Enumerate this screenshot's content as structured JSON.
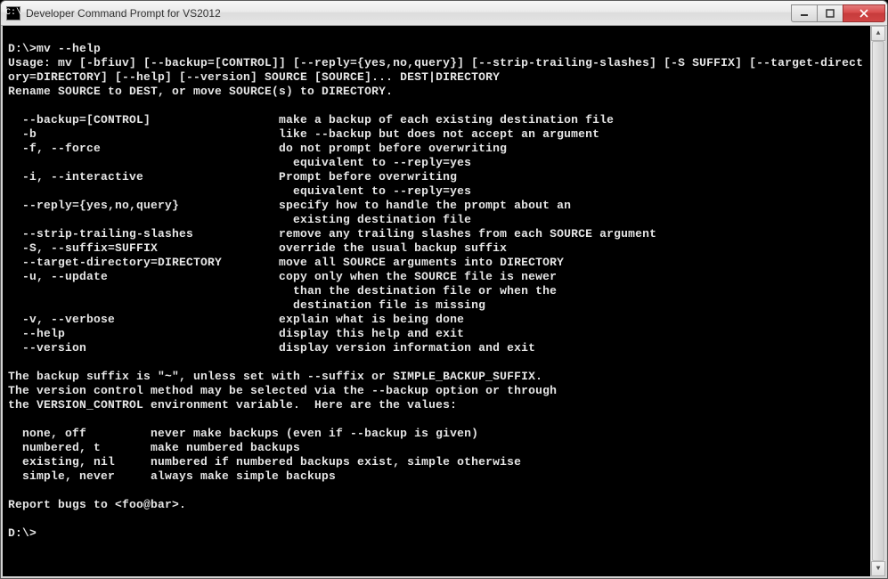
{
  "window": {
    "title": "Developer Command Prompt for VS2012",
    "icon_label": "C:\\"
  },
  "terminal": {
    "prompt1": "D:\\>",
    "command1": "mv --help",
    "usage_line1": "Usage: mv [-bfiuv] [--backup=[CONTROL]] [--reply={yes,no,query}] [--strip-trailing-slashes] [-S SUFFIX] [--target-direct",
    "usage_line2": "ory=DIRECTORY] [--help] [--version] SOURCE [SOURCE]... DEST|DIRECTORY",
    "rename_line": "Rename SOURCE to DEST, or move SOURCE(s) to DIRECTORY.",
    "opts": [
      {
        "opt": "  --backup=[CONTROL]",
        "desc": "make a backup of each existing destination file"
      },
      {
        "opt": "  -b",
        "desc": "like --backup but does not accept an argument"
      },
      {
        "opt": "  -f, --force",
        "desc": "do not prompt before overwriting"
      },
      {
        "opt": "",
        "desc": "  equivalent to --reply=yes"
      },
      {
        "opt": "  -i, --interactive",
        "desc": "Prompt before overwriting"
      },
      {
        "opt": "",
        "desc": "  equivalent to --reply=yes"
      },
      {
        "opt": "  --reply={yes,no,query}",
        "desc": "specify how to handle the prompt about an"
      },
      {
        "opt": "",
        "desc": "  existing destination file"
      },
      {
        "opt": "  --strip-trailing-slashes",
        "desc": "remove any trailing slashes from each SOURCE argument"
      },
      {
        "opt": "  -S, --suffix=SUFFIX",
        "desc": "override the usual backup suffix"
      },
      {
        "opt": "  --target-directory=DIRECTORY",
        "desc": "move all SOURCE arguments into DIRECTORY"
      },
      {
        "opt": "  -u, --update",
        "desc": "copy only when the SOURCE file is newer"
      },
      {
        "opt": "",
        "desc": "  than the destination file or when the"
      },
      {
        "opt": "",
        "desc": "  destination file is missing"
      },
      {
        "opt": "  -v, --verbose",
        "desc": "explain what is being done"
      },
      {
        "opt": "  --help",
        "desc": "display this help and exit"
      },
      {
        "opt": "  --version",
        "desc": "display version information and exit"
      }
    ],
    "suffix_line1": "The backup suffix is \"~\", unless set with --suffix or SIMPLE_BACKUP_SUFFIX.",
    "suffix_line2": "The version control method may be selected via the --backup option or through",
    "suffix_line3": "the VERSION_CONTROL environment variable.  Here are the values:",
    "vc": [
      {
        "key": "  none, off",
        "desc": "never make backups (even if --backup is given)"
      },
      {
        "key": "  numbered, t",
        "desc": "make numbered backups"
      },
      {
        "key": "  existing, nil",
        "desc": "numbered if numbered backups exist, simple otherwise"
      },
      {
        "key": "  simple, never",
        "desc": "always make simple backups"
      }
    ],
    "report": "Report bugs to <foo@bar>.",
    "prompt2": "D:\\>"
  }
}
